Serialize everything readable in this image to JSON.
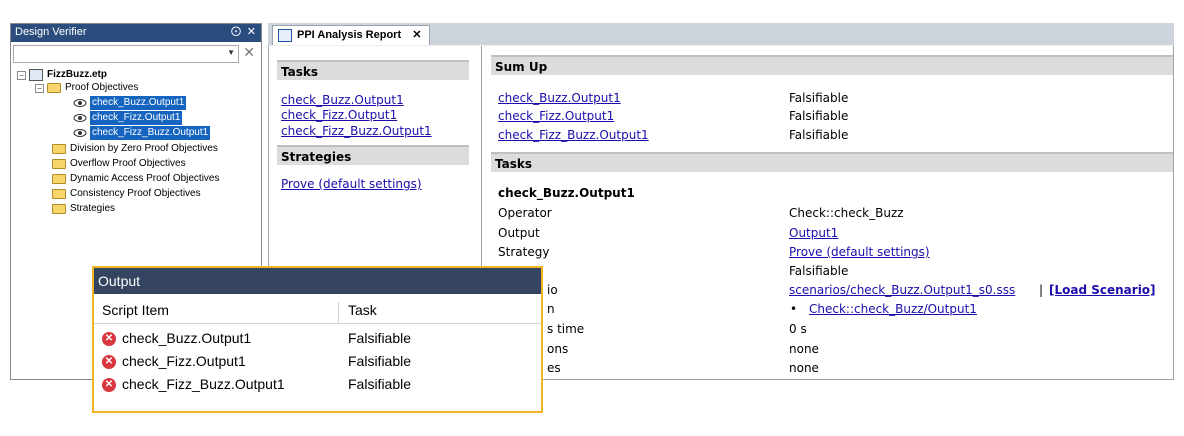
{
  "design_verifier": {
    "title": "Design Verifier",
    "pin_glyph": "⨀",
    "close_glyph": "✕",
    "tree": {
      "project": "FizzBuzz.etp",
      "proof_objectives": "Proof Objectives",
      "objectives": [
        "check_Buzz.Output1",
        "check_Fizz.Output1",
        "check_Fizz_Buzz.Output1"
      ],
      "folders": [
        "Division by Zero Proof Objectives",
        "Overflow Proof Objectives",
        "Dynamic Access Proof Objectives",
        "Consistency Proof Objectives",
        "Strategies"
      ]
    }
  },
  "tab": {
    "label": "PPI Analysis Report",
    "close": "✕"
  },
  "report": {
    "tasks_header": "Tasks",
    "task_links": [
      "check_Buzz.Output1",
      "check_Fizz.Output1",
      "check_Fizz_Buzz.Output1"
    ],
    "strategies_header": "Strategies",
    "strategy_link": "Prove (default settings)",
    "sumup_header": "Sum Up",
    "sumup_rows": [
      {
        "name": "check_Buzz.Output1",
        "result": "Falsifiable"
      },
      {
        "name": "check_Fizz.Output1",
        "result": "Falsifiable"
      },
      {
        "name": "check_Fizz_Buzz.Output1",
        "result": "Falsifiable"
      }
    ],
    "tasks_detail_header": "Tasks",
    "task_title": "check_Buzz.Output1",
    "details": {
      "operator_label": "Operator",
      "operator_value": "Check::check_Buzz",
      "output_label": "Output",
      "output_value": "Output1",
      "strategy_label": "Strategy",
      "strategy_value": "Prove (default settings)",
      "result_value": "Falsifiable",
      "scenario_label_fragment": "io",
      "scenario_value": "scenarios/check_Buzz.Output1_s0.sss",
      "scenario_sep": "|",
      "load_scenario": "[Load Scenario]",
      "path_label_fragment": "n",
      "path_bullet": "•",
      "path_value": "Check::check_Buzz/Output1",
      "time_label_fragment": "s time",
      "time_value": "0 s",
      "ions_label_fragment": "ons",
      "ions_value": "none",
      "es_label_fragment": "es",
      "es_value": "none"
    }
  },
  "output_panel": {
    "title": "Output",
    "col_script": "Script Item",
    "col_task": "Task",
    "err_glyph": "✕",
    "rows": [
      {
        "item": "check_Buzz.Output1",
        "task": "Falsifiable"
      },
      {
        "item": "check_Fizz.Output1",
        "task": "Falsifiable"
      },
      {
        "item": "check_Fizz_Buzz.Output1",
        "task": "Falsifiable"
      }
    ]
  }
}
